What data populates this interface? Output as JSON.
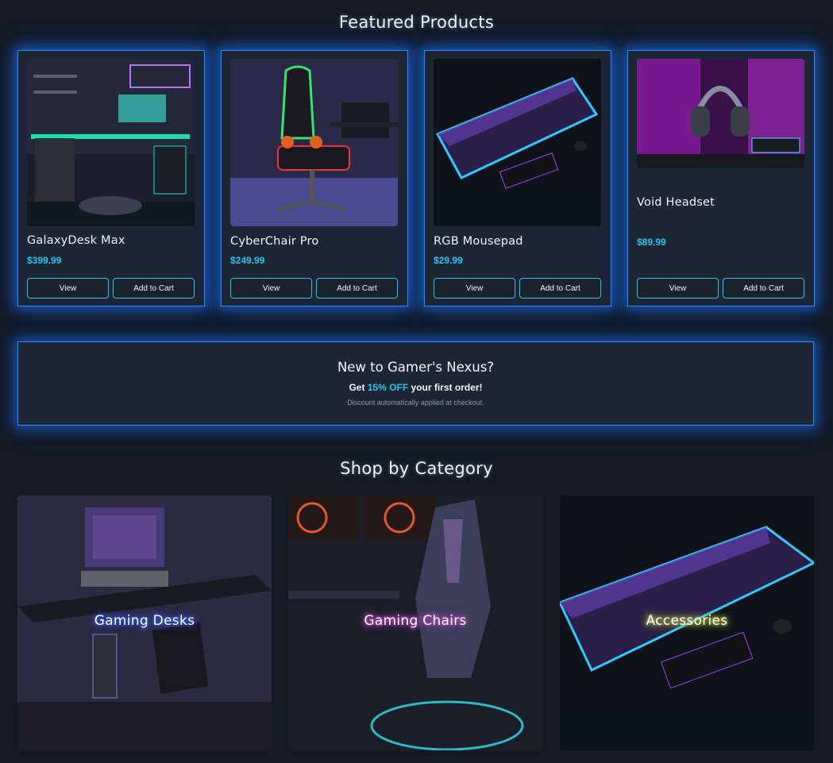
{
  "featured": {
    "title": "Featured Products",
    "products": [
      {
        "name": "GalaxyDesk Max",
        "price": "$399.99",
        "view_label": "View",
        "cart_label": "Add to Cart"
      },
      {
        "name": "CyberChair Pro",
        "price": "$249.99",
        "view_label": "View",
        "cart_label": "Add to Cart"
      },
      {
        "name": "RGB Mousepad",
        "price": "$29.99",
        "view_label": "View",
        "cart_label": "Add to Cart"
      },
      {
        "name": "Void Headset",
        "price": "$89.99",
        "view_label": "View",
        "cart_label": "Add to Cart"
      }
    ]
  },
  "promo": {
    "title": "New to Gamer's Nexus?",
    "offer_prefix": "Get ",
    "offer_highlight": "15% OFF",
    "offer_suffix": " your first order!",
    "note": "Discount automatically applied at checkout."
  },
  "categories": {
    "title": "Shop by Category",
    "items": [
      {
        "label": "Gaming Desks",
        "glow": "#3a5cff"
      },
      {
        "label": "Gaming Chairs",
        "glow": "#d04ad8"
      },
      {
        "label": "Accessories",
        "glow": "#d8e860"
      }
    ]
  },
  "colors": {
    "accent": "#27c4ef",
    "border_glow": "#2f8cff",
    "background": "#131a24",
    "card": "#1d2634"
  }
}
